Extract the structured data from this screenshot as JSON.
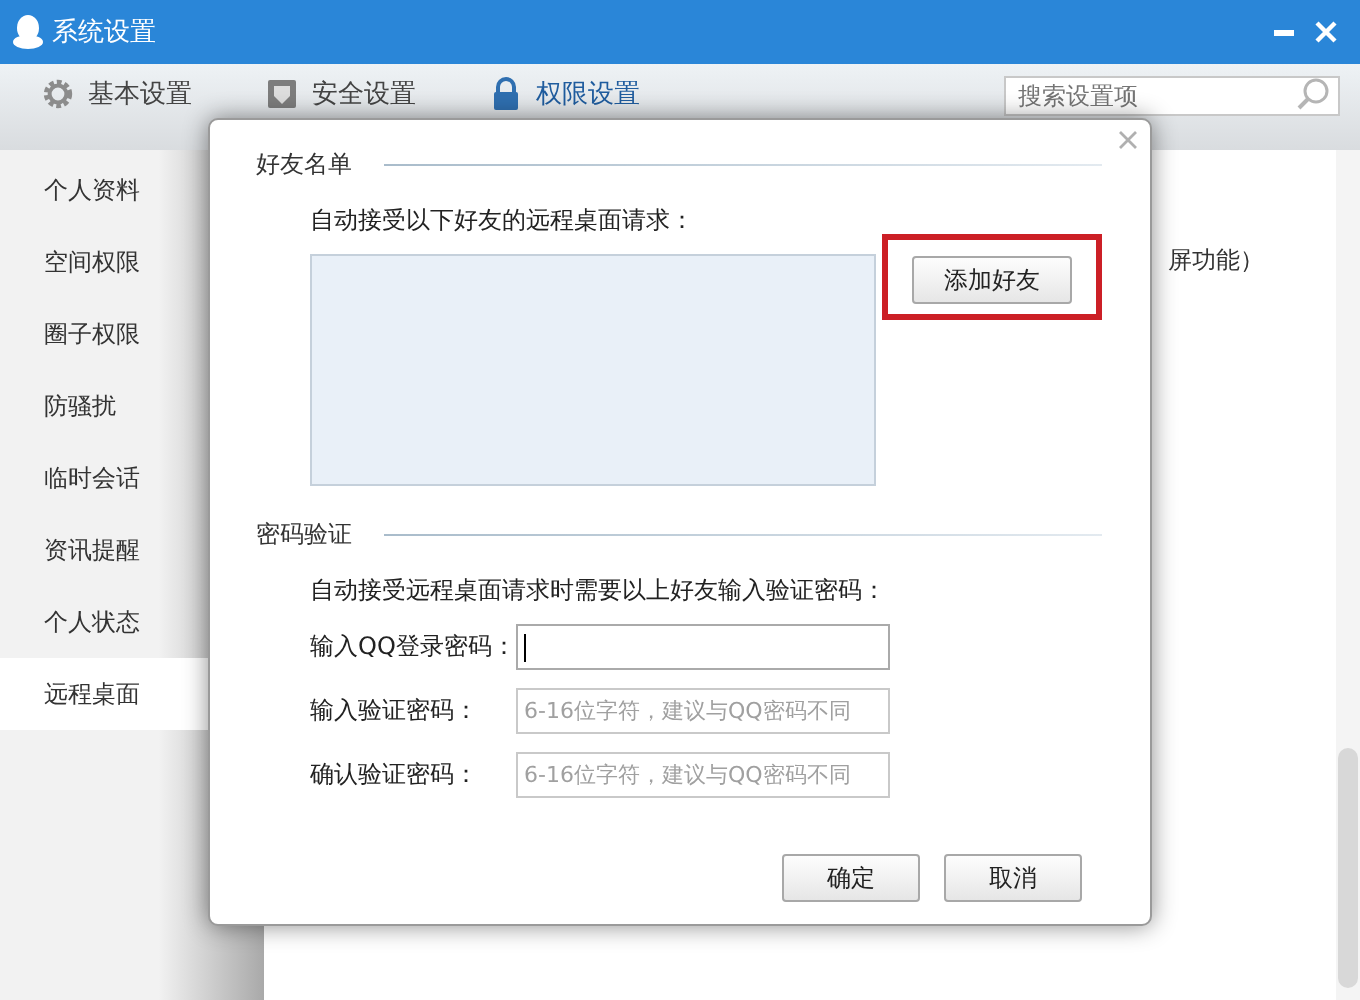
{
  "window": {
    "title": "系统设置"
  },
  "tabs": [
    {
      "label": "基本设置",
      "selected": false
    },
    {
      "label": "安全设置",
      "selected": false
    },
    {
      "label": "权限设置",
      "selected": true
    }
  ],
  "search": {
    "placeholder": "搜索设置项"
  },
  "sidebar": {
    "items": [
      {
        "label": "个人资料",
        "selected": false
      },
      {
        "label": "空间权限",
        "selected": false
      },
      {
        "label": "圈子权限",
        "selected": false
      },
      {
        "label": "防骚扰",
        "selected": false
      },
      {
        "label": "临时会话",
        "selected": false
      },
      {
        "label": "资讯提醒",
        "selected": false
      },
      {
        "label": "个人状态",
        "selected": false
      },
      {
        "label": "远程桌面",
        "selected": true
      }
    ]
  },
  "content": {
    "partial_text": "屏功能）"
  },
  "dialog": {
    "friends_section": {
      "title": "好友名单",
      "description": "自动接受以下好友的远程桌面请求：",
      "add_button": "添加好友",
      "add_button_highlighted": true
    },
    "password_section": {
      "title": "密码验证",
      "description": "自动接受远程桌面请求时需要以上好友输入验证密码：",
      "fields": [
        {
          "label": "输入QQ登录密码：",
          "focused": true
        },
        {
          "label": "输入验证密码：",
          "placeholder": "6-16位字符，建议与QQ密码不同",
          "focused": false
        },
        {
          "label": "确认验证密码：",
          "placeholder": "6-16位字符，建议与QQ密码不同",
          "focused": false
        }
      ]
    },
    "buttons": [
      "确定",
      "取消"
    ]
  }
}
